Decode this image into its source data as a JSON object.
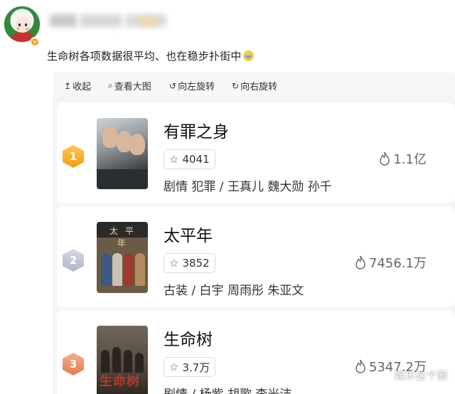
{
  "post": {
    "text": "生命树各项数据很平均、",
    "text_suffix": "也在稳步扑街中",
    "emoji": "laughing-tears-emoji"
  },
  "toolbar": {
    "collapse_label": "收起",
    "view_large_label": "查看大图",
    "rotate_left_label": "向左旋转",
    "rotate_right_label": "向右旋转"
  },
  "dramas": [
    {
      "rank": "1",
      "title": "有罪之身",
      "rating": "4041",
      "heat": "1.1亿",
      "tags": "剧情 犯罪 / 王真儿 魏大勋 孙千"
    },
    {
      "rank": "2",
      "title": "太平年",
      "rating": "3852",
      "heat": "7456.1万",
      "tags": "古装 / 白宇 周雨彤 朱亚文",
      "poster_text": "太平年"
    },
    {
      "rank": "3",
      "title": "生命树",
      "rating": "3.7万",
      "heat": "5347.2万",
      "tags": "剧情 / 杨紫 胡歌 李光洁",
      "poster_text": "生命树"
    }
  ],
  "watermark": "娱乐这个圈",
  "colors": {
    "rank1": "#f49d1a",
    "rank2": "#b0b4c6",
    "rank3": "#e37c52"
  }
}
